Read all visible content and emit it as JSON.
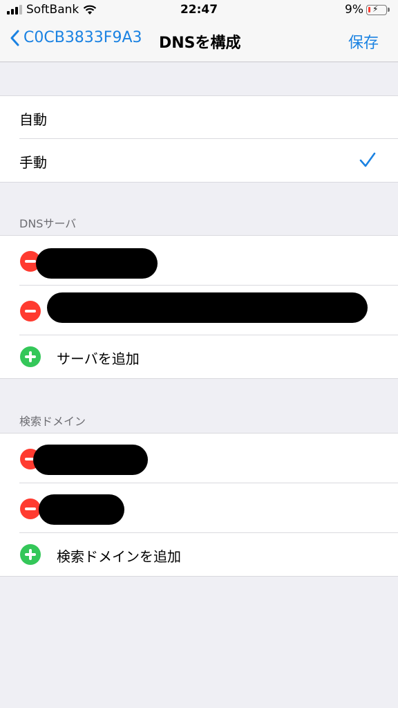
{
  "status_bar": {
    "carrier": "SoftBank",
    "time": "22:47",
    "battery_percent": "9%",
    "battery_level": 0.09
  },
  "nav": {
    "back_label": "C0CB3833F9A3",
    "title": "DNSを構成",
    "save_label": "保存"
  },
  "mode": {
    "options": [
      "自動",
      "手動"
    ],
    "selected": "手動"
  },
  "dns_servers": {
    "header": "DNSサーバ",
    "add_label": "サーバを追加"
  },
  "search_domains": {
    "header": "検索ドメイン",
    "add_label": "検索ドメインを追加"
  },
  "colors": {
    "accent": "#1a82e2",
    "delete": "#ff3b30",
    "add": "#34c759"
  }
}
